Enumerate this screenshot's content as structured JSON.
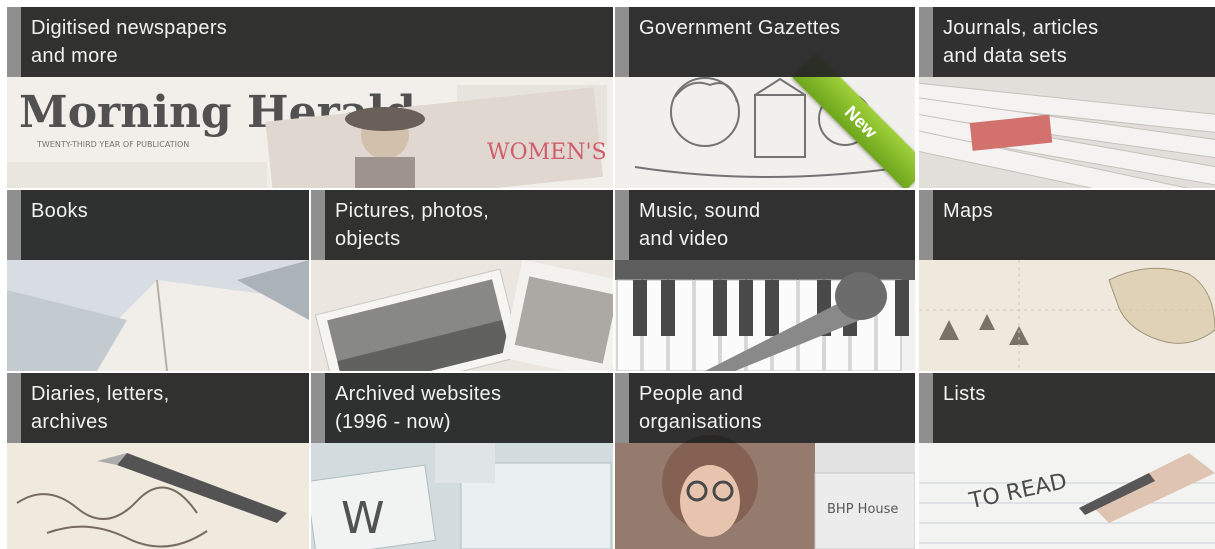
{
  "tiles": [
    {
      "label": "Digitised newspapers\nand more"
    },
    {
      "label": "Government Gazettes",
      "badge": "New"
    },
    {
      "label": "Journals, articles\nand data sets"
    },
    {
      "label": "Books"
    },
    {
      "label": "Pictures, photos,\nobjects"
    },
    {
      "label": "Music, sound\nand video"
    },
    {
      "label": "Maps"
    },
    {
      "label": "Diaries, letters,\narchives"
    },
    {
      "label": "Archived websites\n(1996 - now)"
    },
    {
      "label": "People and\norganisations"
    },
    {
      "label": "Lists"
    }
  ],
  "image_text": {
    "masthead": "Morning Herald.",
    "masthead_sub": "TWENTY-THIRD YEAR OF PUBLICATION",
    "magazine": "WOMEN'S WEEKLY",
    "plaque": "BHP House",
    "note": "TO READ",
    "keys": "W"
  }
}
